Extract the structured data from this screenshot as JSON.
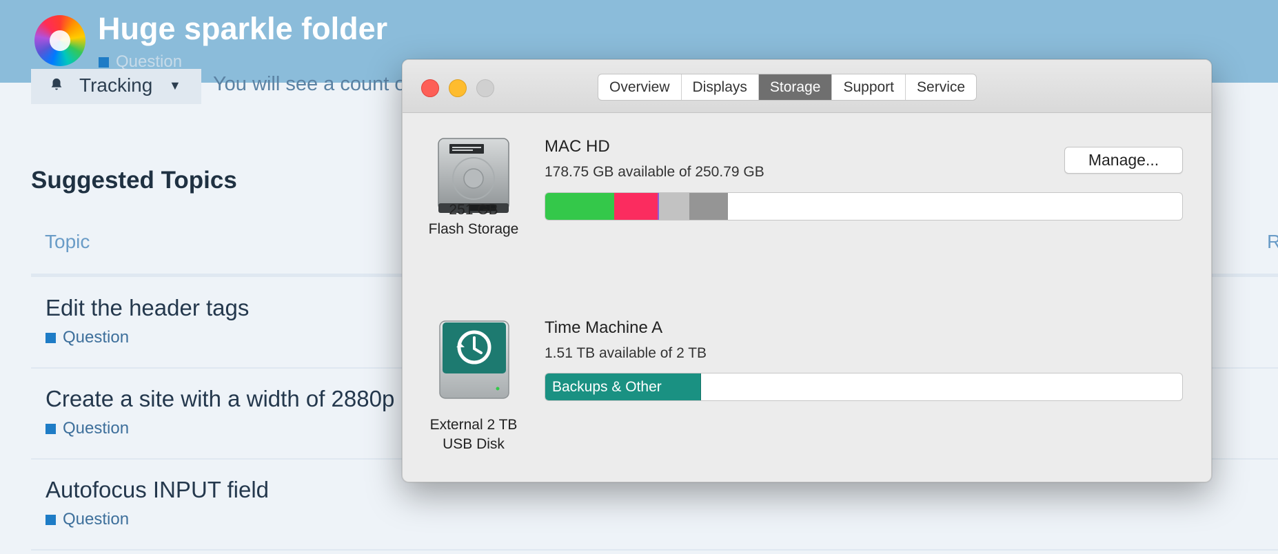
{
  "forum": {
    "site_title": "Huge sparkle folder",
    "site_category": "Question",
    "tracking_label": "Tracking",
    "tracking_note": "You will see a count o",
    "suggested_heading": "Suggested Topics",
    "col_topic": "Topic",
    "col_right": "R",
    "topics": [
      {
        "title": "Edit the header tags",
        "category": "Question"
      },
      {
        "title": "Create a site with a width of 2880p",
        "category": "Question"
      },
      {
        "title": "Autofocus INPUT field",
        "category": "Question"
      }
    ]
  },
  "window": {
    "tabs": [
      {
        "label": "Overview",
        "active": false
      },
      {
        "label": "Displays",
        "active": false
      },
      {
        "label": "Storage",
        "active": true
      },
      {
        "label": "Support",
        "active": false
      },
      {
        "label": "Service",
        "active": false
      }
    ],
    "manage_label": "Manage...",
    "disks": [
      {
        "icon": "hard-drive-icon",
        "name": "MAC HD",
        "available": "178.75 GB available of 250.79 GB",
        "size": "251 GB",
        "type": "Flash Storage"
      },
      {
        "icon": "time-machine-disk-icon",
        "name": "Time Machine A",
        "available": "1.51 TB available of 2 TB",
        "size": "External 2 TB",
        "type": "USB Disk",
        "segment_label": "Backups & Other"
      }
    ]
  },
  "storage_usage": {
    "mac_hd_segments": [
      {
        "color": "#34c84a",
        "fraction": 0.108
      },
      {
        "color": "#fb2c5f",
        "fraction": 0.068
      },
      {
        "color": "#8e5bd6",
        "fraction": 0.003
      },
      {
        "color": "#c2c2c2",
        "fraction": 0.047
      },
      {
        "color": "#959595",
        "fraction": 0.061
      }
    ],
    "time_machine_used_fraction": 0.245
  },
  "colors": {
    "header_bg": "#8bbcda",
    "accent_teal": "#1a9182",
    "category_blue": "#1e7cc6"
  }
}
